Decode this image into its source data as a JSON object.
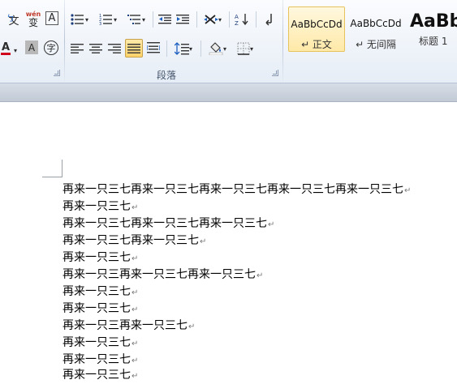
{
  "ribbon": {
    "font_tools": {
      "phonetic_glyph": "文",
      "pinyin_glyph": "wén",
      "pinyin_base": "变",
      "char_border_glyph": "A",
      "font_color_glyph": "A",
      "char_shading_glyph": "A",
      "enclosed_char_glyph": "字"
    },
    "paragraph_group_label": "段落",
    "styles": [
      {
        "sample": "AaBbCcDd",
        "name": "↵ 正文"
      },
      {
        "sample": "AaBbCcDd",
        "name": "↵ 无间隔"
      },
      {
        "sample": "AaBb",
        "name": "标题 1"
      }
    ]
  },
  "document": {
    "lines": [
      "再来一只三七再来一只三七再来一只三七再来一只三七再来一只三七",
      "再来一只三七",
      "再来一只三七再来一只三七再来一只三七",
      "再来一只三七再来一只三七",
      "再来一只三七",
      "再来一只三再来一只三七再来一只三七",
      "再来一只三七",
      "再来一只三七",
      "再来一只三再来一只三七",
      "再来一只三七",
      "再来一只三七",
      "再来一只三七"
    ],
    "paragraph_mark": "↵"
  }
}
